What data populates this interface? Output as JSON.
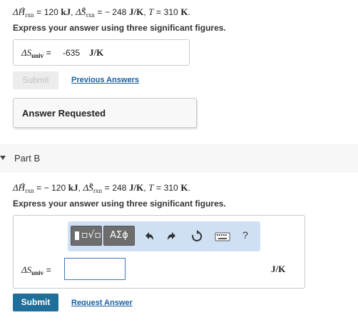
{
  "part_a": {
    "equation": {
      "dh_symbol": "ΔH",
      "dh_sub": "rxn",
      "dh_value": "120",
      "dh_unit": "kJ",
      "ds_symbol": "ΔS",
      "ds_sub": "rxn",
      "ds_value": "− 248",
      "ds_unit": "J/K",
      "t_symbol": "T",
      "t_value": "310",
      "t_unit": "K"
    },
    "instruction": "Express your answer using three significant figures.",
    "answer": {
      "label_symbol": "ΔS",
      "label_sub": "univ",
      "label_eq": "=",
      "value": "-635",
      "unit": "J/K"
    },
    "submit_label": "Submit",
    "previous_answers_label": "Previous Answers",
    "status_label": "Answer Requested"
  },
  "part_b": {
    "title": "Part B",
    "equation": {
      "dh_symbol": "ΔH",
      "dh_sub": "rxn",
      "dh_value": "− 120",
      "dh_unit": "kJ",
      "ds_symbol": "ΔS",
      "ds_sub": "rxn",
      "ds_value": "248",
      "ds_unit": "J/K",
      "t_symbol": "T",
      "t_value": "310",
      "t_unit": "K"
    },
    "instruction": "Express your answer using three significant figures.",
    "toolbar": {
      "template_icon": "templates-icon",
      "greek_label": "ΑΣϕ",
      "undo_icon": "undo-icon",
      "redo_icon": "redo-icon",
      "reset_icon": "reset-icon",
      "keyboard_icon": "keyboard-icon",
      "help_label": "?"
    },
    "answer": {
      "label_symbol": "ΔS",
      "label_sub": "univ",
      "label_eq": "=",
      "value": "",
      "unit": "J/K"
    },
    "submit_label": "Submit",
    "request_answer_label": "Request Answer"
  },
  "colors": {
    "link": "#1a5f9e",
    "submit_bg": "#1f6f9a",
    "toolbar_bg": "#cfe0f5",
    "input_border": "#3b78c2"
  }
}
